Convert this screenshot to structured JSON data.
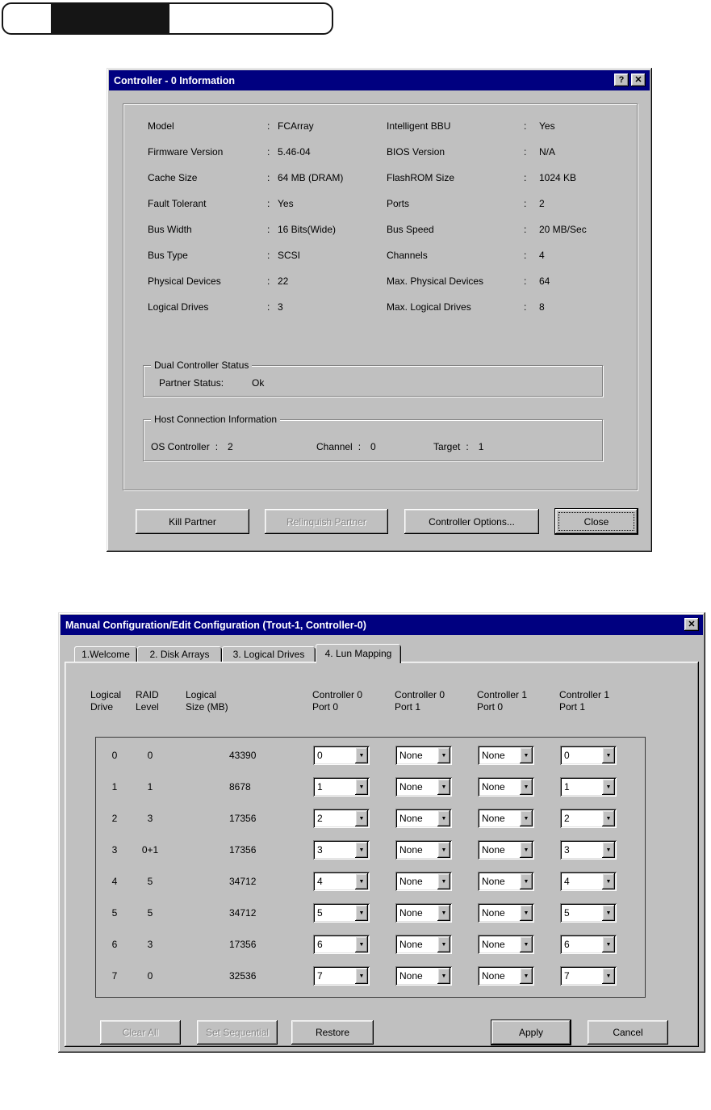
{
  "colon": ":",
  "icons": {
    "help": "?",
    "close": "✕",
    "dropdown": "▼"
  },
  "controller_dialog": {
    "title": "Controller - 0 Information",
    "fields_left": [
      {
        "label": "Model",
        "value": "FCArray"
      },
      {
        "label": "Firmware Version",
        "value": "5.46-04"
      },
      {
        "label": "Cache Size",
        "value": "64 MB (DRAM)"
      },
      {
        "label": "Fault Tolerant",
        "value": "Yes"
      },
      {
        "label": "Bus Width",
        "value": "16 Bits(Wide)"
      },
      {
        "label": "Bus Type",
        "value": "SCSI"
      },
      {
        "label": "Physical Devices",
        "value": "22"
      },
      {
        "label": "Logical Drives",
        "value": "3"
      }
    ],
    "fields_right": [
      {
        "label": "Intelligent BBU",
        "value": "Yes"
      },
      {
        "label": "BIOS Version",
        "value": "N/A"
      },
      {
        "label": "FlashROM Size",
        "value": "1024 KB"
      },
      {
        "label": "Ports",
        "value": "2"
      },
      {
        "label": "Bus Speed",
        "value": "20 MB/Sec"
      },
      {
        "label": "Channels",
        "value": "4"
      },
      {
        "label": "Max. Physical Devices",
        "value": "64"
      },
      {
        "label": "Max. Logical Drives",
        "value": "8"
      }
    ],
    "dual_controller_group": {
      "title": "Dual Controller Status",
      "partner_label": "Partner  Status:",
      "partner_value": "Ok"
    },
    "host_connection_group": {
      "title": "Host Connection Information",
      "items": [
        {
          "label": "OS Controller",
          "value": "2"
        },
        {
          "label": "Channel",
          "value": "0"
        },
        {
          "label": "Target",
          "value": "1"
        }
      ]
    },
    "buttons": [
      {
        "label": "Kill Partner",
        "disabled": false,
        "default": false
      },
      {
        "label": "Relinquish Partner",
        "disabled": true,
        "default": false
      },
      {
        "label": "Controller Options...",
        "disabled": false,
        "default": false
      },
      {
        "label": "Close",
        "disabled": false,
        "default": true
      }
    ]
  },
  "config_dialog": {
    "title": "Manual Configuration/Edit Configuration (Trout-1, Controller-0)",
    "tabs": [
      {
        "label": "1.Welcome",
        "active": false
      },
      {
        "label": "2. Disk Arrays",
        "active": false
      },
      {
        "label": "3. Logical Drives",
        "active": false
      },
      {
        "label": "4. Lun Mapping",
        "active": true
      }
    ],
    "column_headers": [
      "Logical\nDrive",
      "RAID\nLevel",
      "Logical\nSize (MB)",
      "Controller 0\nPort 0",
      "Controller 0\nPort 1",
      "Controller 1\nPort 0",
      "Controller 1\nPort 1"
    ],
    "rows": [
      {
        "drive": "0",
        "raid": "0",
        "size": "43390",
        "luns": [
          "0",
          "None",
          "None",
          "0"
        ]
      },
      {
        "drive": "1",
        "raid": "1",
        "size": "8678",
        "luns": [
          "1",
          "None",
          "None",
          "1"
        ]
      },
      {
        "drive": "2",
        "raid": "3",
        "size": "17356",
        "luns": [
          "2",
          "None",
          "None",
          "2"
        ]
      },
      {
        "drive": "3",
        "raid": "0+1",
        "size": "17356",
        "luns": [
          "3",
          "None",
          "None",
          "3"
        ]
      },
      {
        "drive": "4",
        "raid": "5",
        "size": "34712",
        "luns": [
          "4",
          "None",
          "None",
          "4"
        ]
      },
      {
        "drive": "5",
        "raid": "5",
        "size": "34712",
        "luns": [
          "5",
          "None",
          "None",
          "5"
        ]
      },
      {
        "drive": "6",
        "raid": "3",
        "size": "17356",
        "luns": [
          "6",
          "None",
          "None",
          "6"
        ]
      },
      {
        "drive": "7",
        "raid": "0",
        "size": "32536",
        "luns": [
          "7",
          "None",
          "None",
          "7"
        ]
      }
    ],
    "buttons": [
      {
        "label": "Clear All",
        "disabled": true,
        "default": false
      },
      {
        "label": "Set Sequential",
        "disabled": true,
        "default": false
      },
      {
        "label": "Restore",
        "disabled": false,
        "default": false
      },
      {
        "label": "Apply",
        "disabled": false,
        "default": true
      },
      {
        "label": "Cancel",
        "disabled": false,
        "default": false
      }
    ]
  }
}
